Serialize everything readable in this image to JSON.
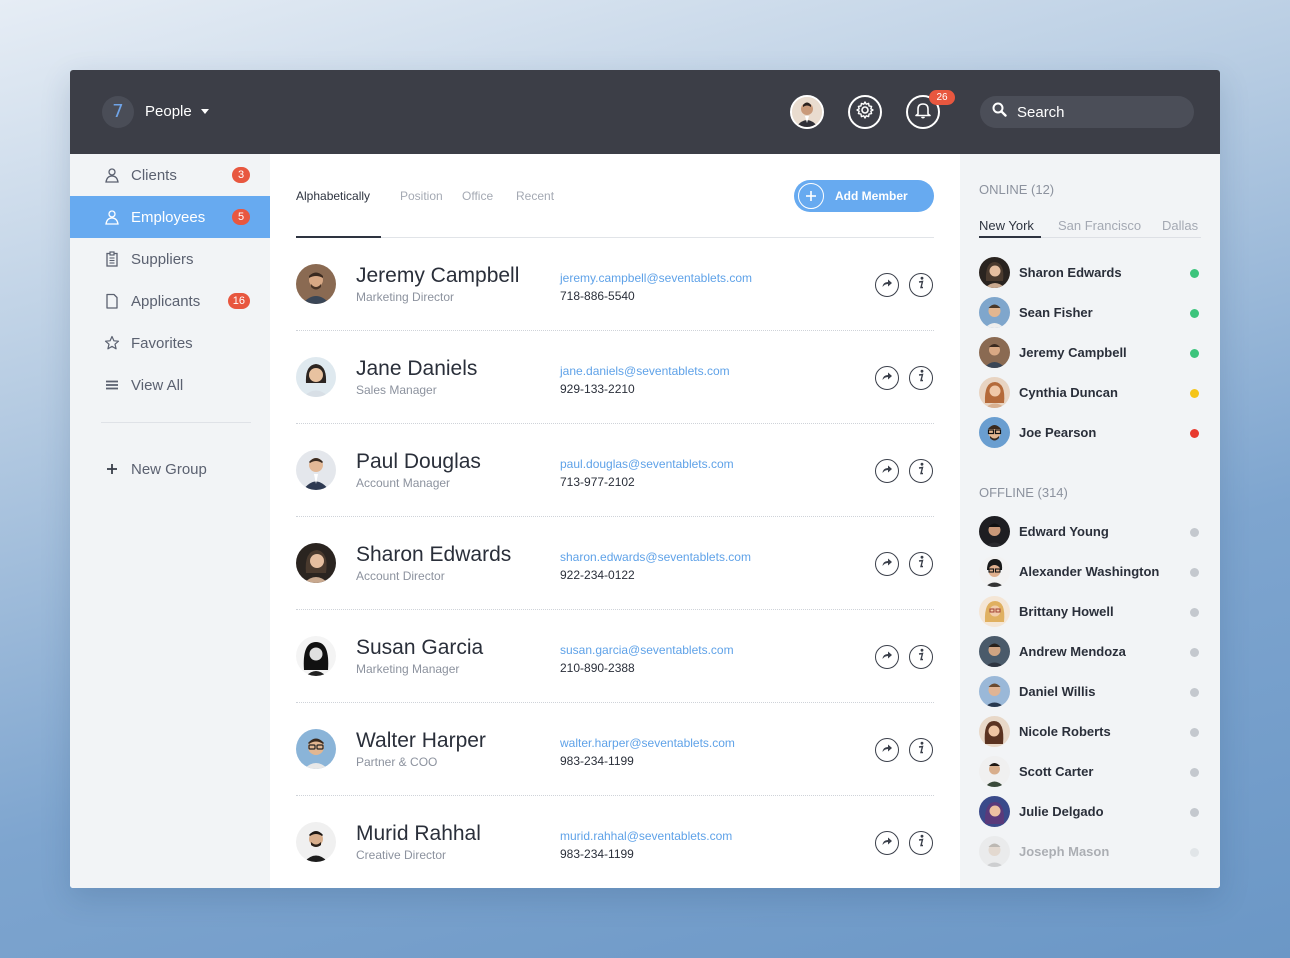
{
  "header": {
    "logo_text": "7",
    "app_title": "People",
    "notification_count": "26",
    "search_placeholder": "Search"
  },
  "sidebar": {
    "items": [
      {
        "label": "Clients",
        "icon": "person-icon",
        "badge": "3"
      },
      {
        "label": "Employees",
        "icon": "person-icon",
        "badge": "5",
        "active": true
      },
      {
        "label": "Suppliers",
        "icon": "clipboard-icon",
        "badge": ""
      },
      {
        "label": "Applicants",
        "icon": "document-icon",
        "badge": "16"
      },
      {
        "label": "Favorites",
        "icon": "star-icon",
        "badge": ""
      },
      {
        "label": "View All",
        "icon": "list-icon",
        "badge": ""
      }
    ],
    "new_group_label": "New Group"
  },
  "main": {
    "tabs": [
      "Alphabetically",
      "Position",
      "Office",
      "Recent"
    ],
    "active_tab": "Alphabetically",
    "add_member_label": "Add Member",
    "members": [
      {
        "name": "Jeremy Campbell",
        "title": "Marketing Director",
        "email": "jeremy.campbell@seventablets.com",
        "phone": "718-886-5540"
      },
      {
        "name": "Jane Daniels",
        "title": "Sales Manager",
        "email": "jane.daniels@seventablets.com",
        "phone": "929-133-2210"
      },
      {
        "name": "Paul Douglas",
        "title": "Account Manager",
        "email": "paul.douglas@seventablets.com",
        "phone": "713-977-2102"
      },
      {
        "name": "Sharon Edwards",
        "title": "Account Director",
        "email": "sharon.edwards@seventablets.com",
        "phone": "922-234-0122"
      },
      {
        "name": "Susan Garcia",
        "title": "Marketing Manager",
        "email": "susan.garcia@seventablets.com",
        "phone": "210-890-2388"
      },
      {
        "name": "Walter Harper",
        "title": "Partner & COO",
        "email": "walter.harper@seventablets.com",
        "phone": "983-234-1199"
      },
      {
        "name": "Murid Rahhal",
        "title": "Creative Director",
        "email": "murid.rahhal@seventablets.com",
        "phone": "983-234-1199"
      }
    ]
  },
  "right_panel": {
    "online_heading": "ONLINE (12)",
    "location_tabs": [
      "New York",
      "San Francisco",
      "Dallas"
    ],
    "active_location": "New York",
    "online": [
      {
        "name": "Sharon Edwards",
        "status": "online"
      },
      {
        "name": "Sean Fisher",
        "status": "online"
      },
      {
        "name": "Jeremy Campbell",
        "status": "online"
      },
      {
        "name": "Cynthia Duncan",
        "status": "away"
      },
      {
        "name": "Joe Pearson",
        "status": "busy"
      }
    ],
    "offline_heading": "OFFLINE (314)",
    "offline": [
      {
        "name": "Edward Young"
      },
      {
        "name": "Alexander Washington"
      },
      {
        "name": "Brittany Howell"
      },
      {
        "name": "Andrew Mendoza"
      },
      {
        "name": "Daniel Willis"
      },
      {
        "name": "Nicole Roberts"
      },
      {
        "name": "Scott Carter"
      },
      {
        "name": "Julie Delgado"
      },
      {
        "name": "Joseph Mason"
      }
    ]
  },
  "colors": {
    "topbar": "#3c3e47",
    "accent": "#67aaf0",
    "badge": "#e8573f",
    "online": "#3cc47c",
    "away": "#f5c518",
    "busy": "#e83a2e",
    "offline": "#c4c8ce"
  }
}
